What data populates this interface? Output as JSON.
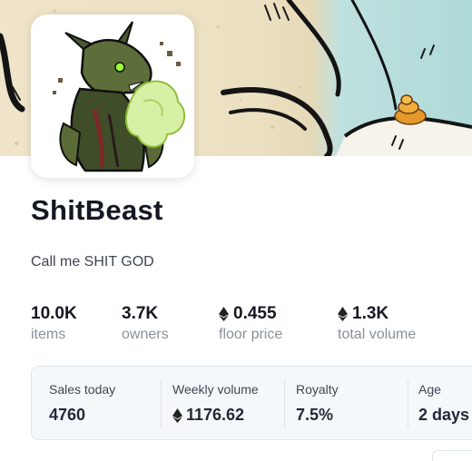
{
  "collection": {
    "name": "ShitBeast",
    "description": "Call me SHIT GOD"
  },
  "stats": [
    {
      "value": "10.0K",
      "label": "items",
      "icon": null
    },
    {
      "value": "3.7K",
      "label": "owners",
      "icon": null
    },
    {
      "value": "0.455",
      "label": "floor price",
      "icon": "ethereum-icon"
    },
    {
      "value": "1.3K",
      "label": "total volume",
      "icon": "ethereum-icon"
    }
  ],
  "summary": [
    {
      "label": "Sales today",
      "value": "4760",
      "icon": null
    },
    {
      "label": "Weekly volume",
      "value": "1176.62",
      "icon": "ethereum-icon"
    },
    {
      "label": "Royalty",
      "value": "7.5%",
      "icon": null
    },
    {
      "label": "Age",
      "value": "2 days",
      "icon": null
    }
  ],
  "colors": {
    "banner_sand": "#ece0c2",
    "banner_sky": "#aed9d9",
    "card_bg": "#f5f8fb",
    "text_primary": "#141822",
    "text_muted": "#8a8f9b"
  }
}
